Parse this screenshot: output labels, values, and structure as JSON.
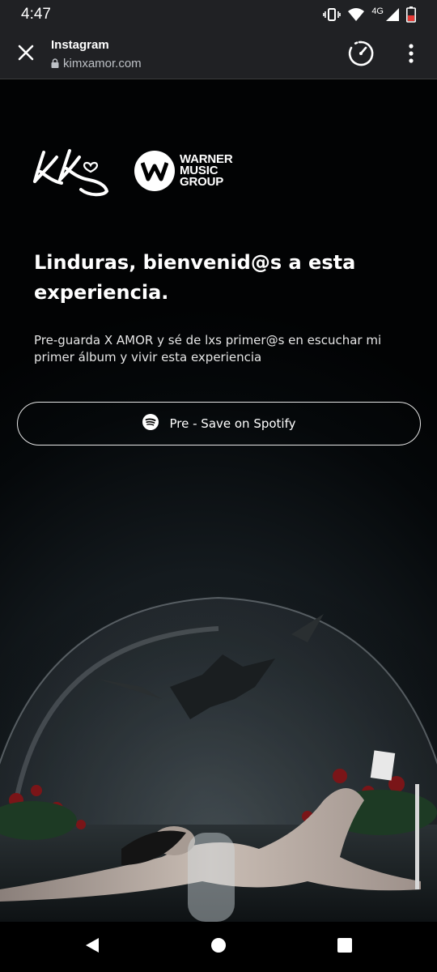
{
  "status_bar": {
    "time": "4:47",
    "network": "4G",
    "icons": [
      "vibrate-icon",
      "wifi-icon",
      "signal-icon",
      "battery-icon"
    ]
  },
  "toolbar": {
    "title": "Instagram",
    "url": "kimxamor.com",
    "icons": [
      "close-icon",
      "lock-icon",
      "lite-mode-icon",
      "more-vert-icon"
    ]
  },
  "page": {
    "logos": {
      "artist_monogram": "KL",
      "label_lines": [
        "WARNER",
        "MUSIC",
        "GROUP"
      ]
    },
    "headline": "Linduras, bienvenid@s a esta experiencia.",
    "subtext": "Pre-guarda X AMOR y sé de lxs primer@s en escuchar mi primer álbum y vivir esta experiencia",
    "presave_button_label": "Pre - Save on Spotify",
    "colors": {
      "background": "#05080a",
      "button_border": "#e6e6e6",
      "text": "#ffffff"
    }
  },
  "nav_bar": {
    "icons": [
      "back-icon",
      "home-icon",
      "recents-icon"
    ]
  }
}
